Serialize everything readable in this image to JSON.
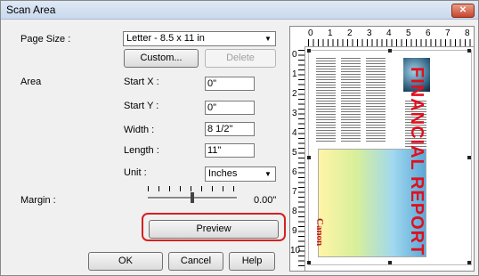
{
  "window": {
    "title": "Scan Area",
    "close_label": "✕"
  },
  "page_size": {
    "label": "Page Size :",
    "value": "Letter - 8.5 x 11 in",
    "custom_label": "Custom...",
    "delete_label": "Delete"
  },
  "area": {
    "label": "Area",
    "start_x_label": "Start X :",
    "start_x": "0\"",
    "start_y_label": "Start Y :",
    "start_y": "0\"",
    "width_label": "Width :",
    "width": "8 1/2\"",
    "length_label": "Length :",
    "length": "11\"",
    "unit_label": "Unit :",
    "unit": "Inches"
  },
  "margin": {
    "label": "Margin :",
    "value": "0.00\"",
    "level": 0.5
  },
  "buttons": {
    "preview": "Preview",
    "ok": "OK",
    "cancel": "Cancel",
    "help": "Help"
  },
  "preview": {
    "ruler_top": [
      "0",
      "1",
      "2",
      "3",
      "4",
      "5",
      "6",
      "7",
      "8"
    ],
    "ruler_left": [
      "0",
      "1",
      "2",
      "3",
      "4",
      "5",
      "6",
      "7",
      "8",
      "9",
      "10"
    ],
    "report_title": "FINANCIAL REPORT",
    "brand": "Canon"
  },
  "colors": {
    "highlight": "#d62020",
    "report_red": "#e0101f"
  }
}
